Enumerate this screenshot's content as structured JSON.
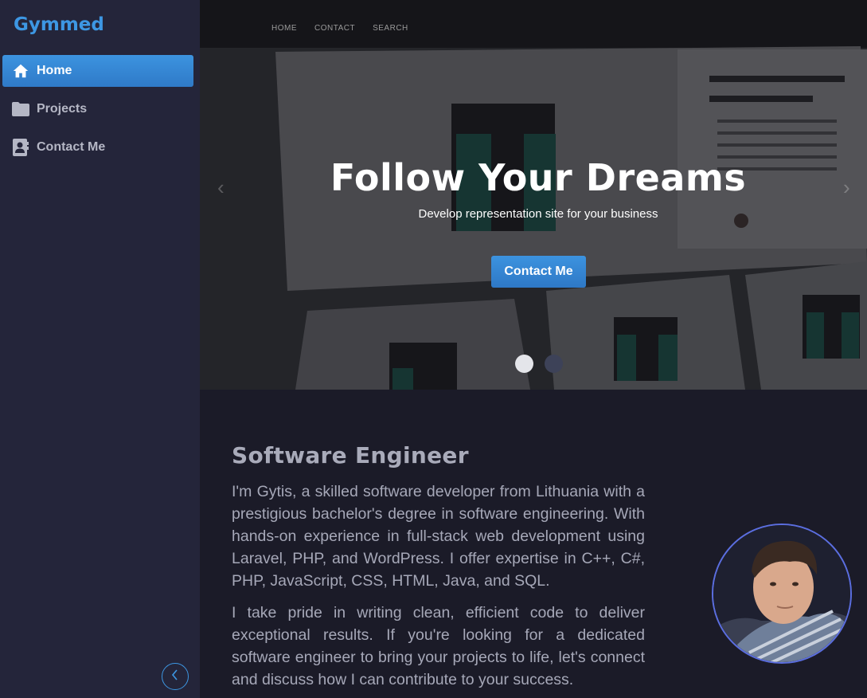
{
  "sidebar": {
    "brand": "Gymmed",
    "items": [
      {
        "label": "Home",
        "icon": "home-icon",
        "active": true
      },
      {
        "label": "Projects",
        "icon": "folder-icon",
        "active": false
      },
      {
        "label": "Contact Me",
        "icon": "contact-book-icon",
        "active": false
      }
    ],
    "collapse_icon": "chevron-left-icon"
  },
  "hero": {
    "topnav": [
      "HOME",
      "CONTACT",
      "SEARCH"
    ],
    "title": "Follow Your Dreams",
    "subtitle": "Develop representation site for your business",
    "button": "Contact Me",
    "slides_total": 2,
    "active_slide": 1
  },
  "about": {
    "heading": "Software Engineer",
    "p1": "I'm Gytis, a skilled software developer from Lithuania with a prestigious bachelor's degree in software engineering. With hands-on experience in full-stack web development using Laravel, PHP, and WordPress. I offer expertise in C++, C#, PHP, JavaScript, CSS, HTML, Java, and SQL.",
    "p2": "I take pride in writing clean, efficient code to deliver exceptional results. If you're looking for a dedicated software engineer to bring your projects to life, let's connect and discuss how I can contribute to your success."
  },
  "colors": {
    "accent": "#3d97e3",
    "sidebar_bg": "#24253a",
    "page_bg": "#1b1b28",
    "avatar_ring": "#5b6ee0"
  }
}
